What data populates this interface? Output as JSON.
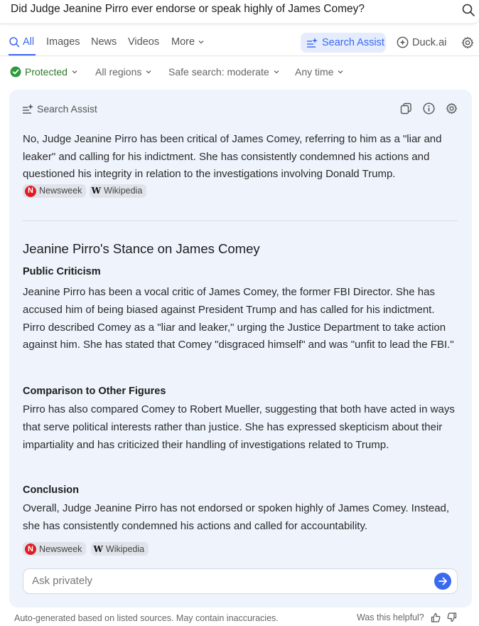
{
  "search": {
    "query": "Did Judge Jeanine Pirro ever endorse or speak highly of James Comey?"
  },
  "tabs": {
    "all": "All",
    "images": "Images",
    "news": "News",
    "videos": "Videos",
    "more": "More",
    "search_assist": "Search Assist",
    "duck_ai": "Duck.ai"
  },
  "filters": {
    "protected": "Protected",
    "regions": "All regions",
    "safe_search": "Safe search: moderate",
    "time": "Any time"
  },
  "assist": {
    "header": "Search Assist",
    "summary": "No, Judge Jeanine Pirro has been critical of James Comey, referring to him as a \"liar and leaker\" and calling for his indictment. She has consistently condemned his actions and questioned his integrity in relation to the investigations involving Donald Trump.",
    "sources": [
      {
        "name": "Newsweek",
        "icon": "N"
      },
      {
        "name": "Wikipedia",
        "icon": "W"
      }
    ],
    "title": "Jeanine Pirro's Stance on James Comey",
    "sections": [
      {
        "heading": "Public Criticism",
        "body": "Jeanine Pirro has been a vocal critic of James Comey, the former FBI Director. She has accused him of being biased against President Trump and has called for his indictment. Pirro described Comey as a \"liar and leaker,\" urging the Justice Department to take action against him. She has stated that Comey \"disgraced himself\" and was \"unfit to lead the FBI.\""
      },
      {
        "heading": "Comparison to Other Figures",
        "body": "Pirro has also compared Comey to Robert Mueller, suggesting that both have acted in ways that serve political interests rather than justice. She has expressed skepticism about their impartiality and has criticized their handling of investigations related to Trump."
      },
      {
        "heading": "Conclusion",
        "body": "Overall, Judge Jeanine Pirro has not endorsed or spoken highly of James Comey. Instead, she has consistently condemned his actions and called for accountability."
      }
    ],
    "ask_placeholder": "Ask privately"
  },
  "footer": {
    "disclaimer": "Auto-generated based on listed sources. May contain inaccuracies.",
    "helpful": "Was this helpful?"
  },
  "colors": {
    "accent": "#3969ef",
    "card_bg": "#eef3fc",
    "protected_green": "#2c7a2c",
    "newsweek_red": "#e31b23"
  }
}
